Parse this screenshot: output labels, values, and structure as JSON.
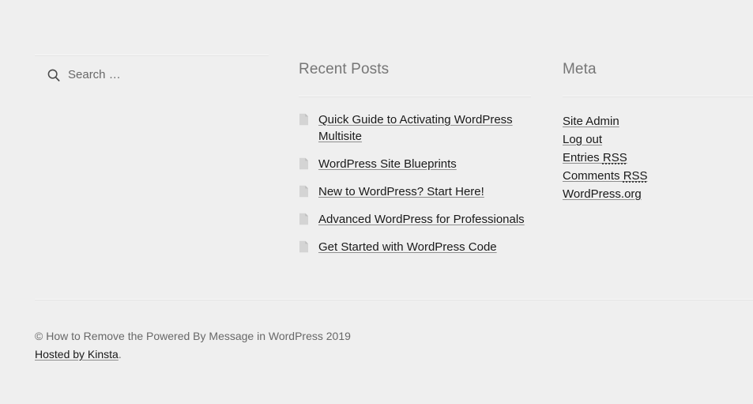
{
  "theme": {
    "background_color": "#efefef",
    "heading_color": "#767676",
    "link_color": "#1a1a1a",
    "muted_text_color": "#686868",
    "separator_color": "#e3e3e3"
  },
  "search": {
    "icon": "search-icon",
    "placeholder": "Search …",
    "value": ""
  },
  "recent_posts": {
    "title": "Recent Posts",
    "item_icon": "document-icon",
    "items": [
      {
        "label": "Quick Guide to Activating WordPress Multisite"
      },
      {
        "label": "WordPress Site Blueprints"
      },
      {
        "label": "New to WordPress? Start Here!"
      },
      {
        "label": "Advanced WordPress for Professionals"
      },
      {
        "label": "Get Started with WordPress Code"
      }
    ]
  },
  "meta": {
    "title": "Meta",
    "items": [
      {
        "label": "Site Admin",
        "abbr": ""
      },
      {
        "label": "Log out",
        "abbr": ""
      },
      {
        "label": "Entries ",
        "abbr": "RSS"
      },
      {
        "label": "Comments ",
        "abbr": "RSS"
      },
      {
        "label": "WordPress.org",
        "abbr": ""
      }
    ]
  },
  "footer": {
    "copyright": "© How to Remove the Powered By Message in WordPress 2019",
    "host_link": "Hosted by Kinsta",
    "host_suffix": "."
  }
}
